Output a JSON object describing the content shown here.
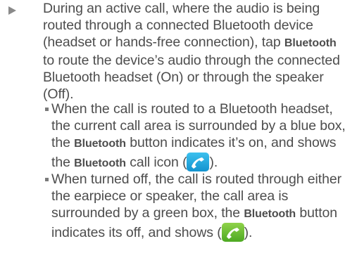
{
  "main_item": {
    "lines": [
      "During an active call, where the audio is being",
      "routed through a connected Bluetooth device",
      "(headset or hands-free connection), tap ",
      " to route the device’s audio through the connected",
      "Bluetooth headset (On) or through the speaker",
      "(Off)."
    ],
    "bold_bluetooth": "Bluetooth"
  },
  "sub_item_1": {
    "line1": "When the call is routed to a Bluetooth headset,",
    "line2": "the current call area is surrounded by a blue box,",
    "line3_pre": "the ",
    "line3_bold": "Bluetooth",
    "line3_post": " button indicates it’s on, and shows",
    "line4_pre": "the ",
    "line4_bold": "Bluetooth",
    "line4_mid": " call icon (",
    "line4_post": ").",
    "icon": "bluetooth-call-icon-blue",
    "icon_color": "#1e9fd8"
  },
  "sub_item_2": {
    "line1": "When turned off, the call is routed through either",
    "line2": "the earpiece or speaker, the call area is",
    "line3_pre": "surrounded by a green box, the ",
    "line3_bold": "Bluetooth",
    "line3_post": " button",
    "line4_pre": "indicates its off, and shows (",
    "line4_post": ").",
    "icon": "call-icon-green",
    "icon_color": "#5cb82a"
  }
}
